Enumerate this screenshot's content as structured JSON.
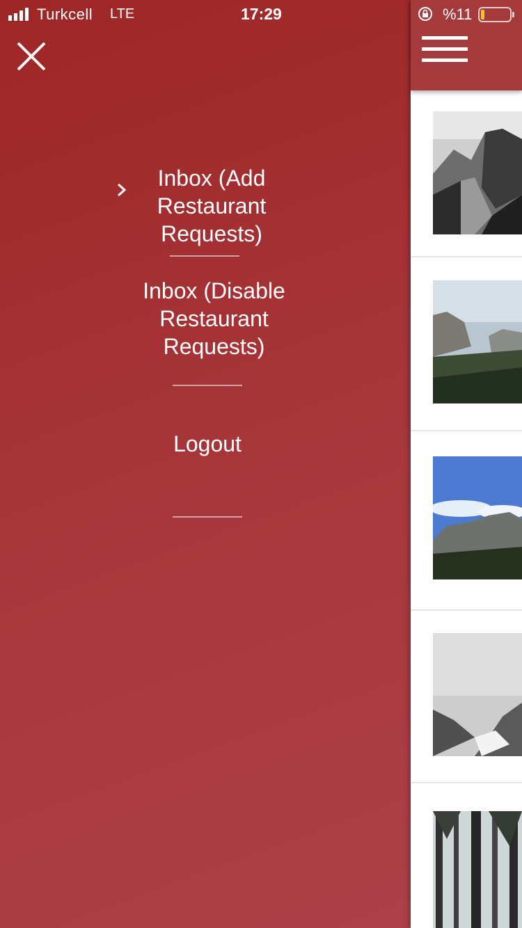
{
  "status_bar": {
    "carrier": "Turkcell",
    "network": "LTE",
    "time": "17:29",
    "battery_percent": "%11",
    "battery_level": 0.11,
    "signal_bars": 4
  },
  "drawer": {
    "menu_items": [
      {
        "label_lines": [
          "Inbox (Add",
          "Restaurant",
          "Requests)"
        ],
        "active": true
      },
      {
        "label_lines": [
          "Inbox (Disable",
          "Restaurant",
          "Requests)"
        ],
        "active": false
      },
      {
        "label_lines": [
          "Logout"
        ],
        "active": false
      }
    ],
    "icons": {
      "close": "close-icon",
      "active_indicator": "chevron-right-icon"
    }
  },
  "main": {
    "header_icon": "hamburger-menu-icon",
    "cards": [
      {
        "image": "mountain-photo-bw"
      },
      {
        "image": "valley-photo"
      },
      {
        "image": "mountain-blue-sky-photo"
      },
      {
        "image": "foggy-valley-photo"
      },
      {
        "image": "forest-photo"
      }
    ]
  },
  "colors": {
    "drawer_bg": "#a53436",
    "header_bg": "#a53a3d",
    "battery_low": "#f5c518"
  }
}
